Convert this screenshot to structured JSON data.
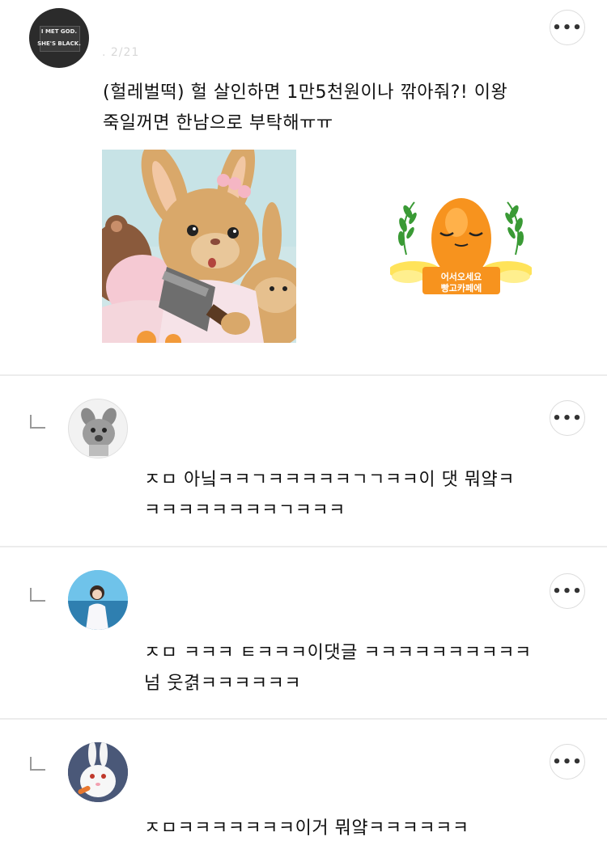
{
  "comments": [
    {
      "id": "c1",
      "avatar_caption": [
        "I MET GOD.",
        "SHE'S BLACK."
      ],
      "meta": ".    2/21",
      "text": "(헐레벌떡) 헐 살인하면 1만5천원이나 깎아줘?! 이왕\n죽일꺼면 한남으로 부탁해ㅠㅠ",
      "sticker_caption": [
        "어서오세요",
        "빵고카페에"
      ]
    },
    {
      "id": "r1",
      "text": "ㅈㅁ 아닠ㅋㅋㄱㅋㅋㅋㅋㅋㄱㄱㅋㅋ이 댓 뭐얔ㅋ\nㅋㅋㅋㅋㅋㅋㅋㅋㄱㅋㅋㅋ"
    },
    {
      "id": "r2",
      "text": "ㅈㅁ ㅋㅋㅋ ㅌㅋㅋㅋ이댓글 ㅋㅋㅋㅋㅋㅋㅋㅋㅋㅋ\n넘 웃겱ㅋㅋㅋㅋㅋㅋ"
    },
    {
      "id": "r3",
      "text": "ㅈㅁㅋㅋㅋㅋㅋㅋㅋ이거 뭐얔ㅋㅋㅋㅋㅋㅋ"
    }
  ],
  "more_button_label": "•••",
  "colors": {
    "divider": "#ececec",
    "text": "#111111",
    "sticker_orange": "#f7931e",
    "sticker_leaf": "#3a9a35",
    "sticker_wing": "#ffe35a"
  },
  "icons": [
    "more-options-icon",
    "reply-arrow-icon"
  ]
}
